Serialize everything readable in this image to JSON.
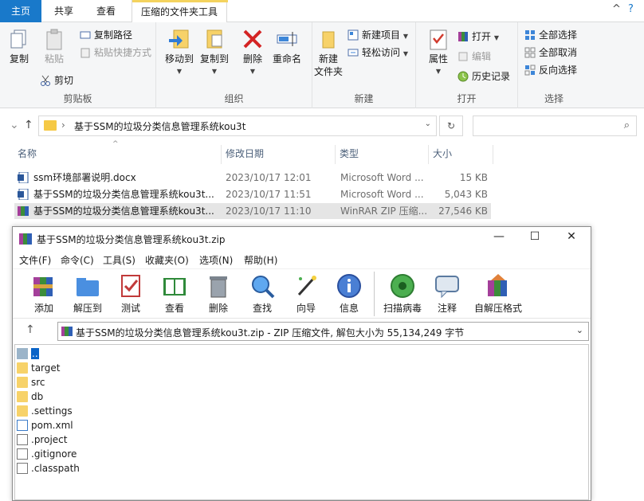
{
  "ribbon_tabs": {
    "home": "主页",
    "share": "共享",
    "view": "查看",
    "compressed_tools": "压缩的文件夹工具"
  },
  "window_controls": {
    "help": "?",
    "collapse": "^"
  },
  "ribbon": {
    "clipboard": {
      "label": "剪贴板",
      "copy": "复制",
      "paste": "粘贴",
      "copy_path": "复制路径",
      "paste_shortcut": "粘贴快捷方式",
      "cut": "剪切"
    },
    "organize": {
      "label": "组织",
      "move_to": "移动到",
      "copy_to": "复制到",
      "delete": "删除",
      "rename": "重命名"
    },
    "new": {
      "label": "新建",
      "new_folder_1": "新建",
      "new_folder_2": "文件夹",
      "new_item": "新建项目",
      "easy_access": "轻松访问"
    },
    "open": {
      "label": "打开",
      "properties": "属性",
      "open": "打开",
      "edit": "编辑",
      "history": "历史记录"
    },
    "select": {
      "label": "选择",
      "select_all": "全部选择",
      "select_none": "全部取消",
      "invert": "反向选择"
    }
  },
  "address": {
    "path": "基于SSM的垃圾分类信息管理系统kou3t"
  },
  "columns": {
    "name": "名称",
    "date": "修改日期",
    "type": "类型",
    "size": "大小"
  },
  "files": [
    {
      "name": "ssm环境部署说明.docx",
      "date": "2023/10/17 12:01",
      "type": "Microsoft Word ...",
      "size": "15 KB"
    },
    {
      "name": "基于SSM的垃圾分类信息管理系统kou3t...",
      "date": "2023/10/17 11:51",
      "type": "Microsoft Word ...",
      "size": "5,043 KB"
    },
    {
      "name": "基于SSM的垃圾分类信息管理系统kou3t...",
      "date": "2023/10/17 11:10",
      "type": "WinRAR ZIP 压缩...",
      "size": "27,546 KB"
    }
  ],
  "winrar": {
    "title": "基于SSM的垃圾分类信息管理系统kou3t.zip",
    "menus": [
      "文件(F)",
      "命令(C)",
      "工具(S)",
      "收藏夹(O)",
      "选项(N)",
      "帮助(H)"
    ],
    "tools": [
      "添加",
      "解压到",
      "测试",
      "查看",
      "删除",
      "查找",
      "向导",
      "信息",
      "扫描病毒",
      "注释",
      "自解压格式"
    ],
    "archive_info": "基于SSM的垃圾分类信息管理系统kou3t.zip - ZIP 压缩文件, 解包大小为 55,134,249 字节",
    "items": [
      {
        "name": "..",
        "kind": "up"
      },
      {
        "name": "target",
        "kind": "folder"
      },
      {
        "name": "src",
        "kind": "folder"
      },
      {
        "name": "db",
        "kind": "folder"
      },
      {
        "name": ".settings",
        "kind": "folder"
      },
      {
        "name": "pom.xml",
        "kind": "xml"
      },
      {
        "name": ".project",
        "kind": "file"
      },
      {
        "name": ".gitignore",
        "kind": "file"
      },
      {
        "name": ".classpath",
        "kind": "file"
      }
    ]
  }
}
